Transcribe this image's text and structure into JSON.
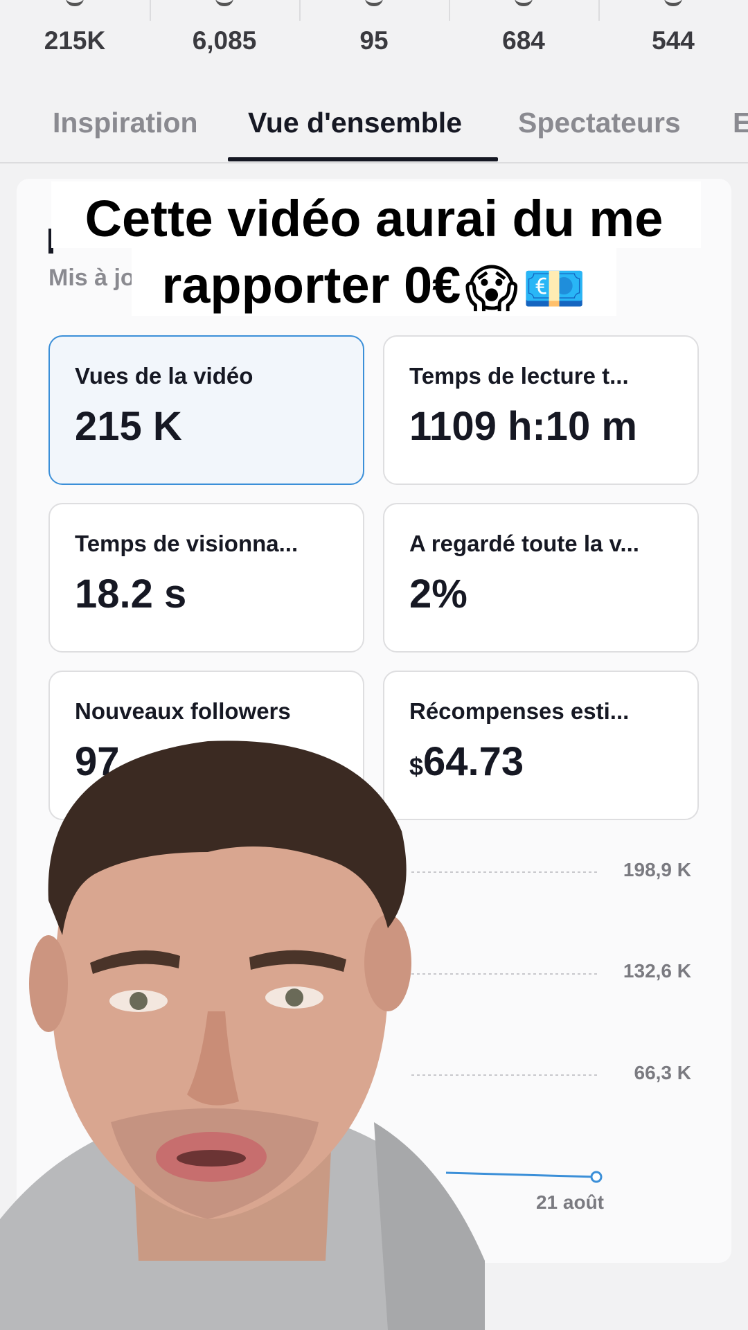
{
  "stats": [
    "215K",
    "6,085",
    "95",
    "684",
    "544"
  ],
  "tabs": [
    {
      "label": "Inspiration",
      "active": false
    },
    {
      "label": "Vue d'ensemble",
      "active": true
    },
    {
      "label": "Spectateurs",
      "active": false
    },
    {
      "label": "E",
      "active": false
    }
  ],
  "card": {
    "updated_fragment": "Mis à jo"
  },
  "caption": {
    "line1": "Cette vidéo aurai du me",
    "line2": "rapporter 0€",
    "emoji1": "😱",
    "emoji2": "💶"
  },
  "metrics": [
    {
      "label": "Vues de la vidéo",
      "value": "215 K",
      "selected": true
    },
    {
      "label": "Temps de lecture t...",
      "value": "1109 h:10 m",
      "selected": false
    },
    {
      "label": "Temps de visionna...",
      "value": "18.2 s",
      "selected": false
    },
    {
      "label": "A regardé toute la v...",
      "value": "2%",
      "selected": false
    },
    {
      "label": "Nouveaux followers",
      "value": "97",
      "selected": false
    },
    {
      "label": "Récompenses esti...",
      "currency": "$",
      "value": "64.73",
      "selected": false
    }
  ],
  "chart_data": {
    "type": "line",
    "y_ticks": [
      "198,9 K",
      "132,6 K",
      "66,3 K"
    ],
    "x_label_visible": "21 août",
    "series_color": "#3b8fd8",
    "grid": "dotted horizontal"
  },
  "colors": {
    "accent": "#3b8fd8",
    "text": "#161823",
    "muted": "#8a8a90"
  }
}
